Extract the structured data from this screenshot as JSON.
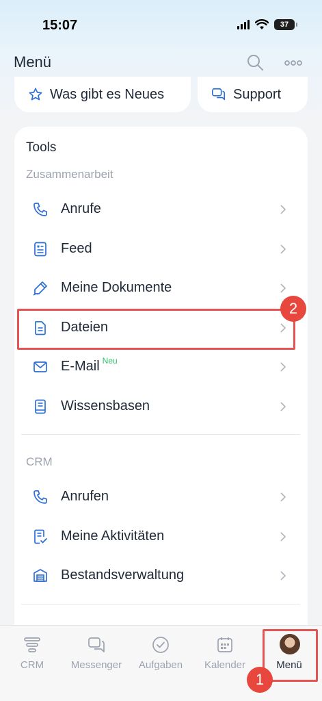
{
  "status": {
    "time": "15:07",
    "battery": "37"
  },
  "header": {
    "title": "Menü"
  },
  "quick": {
    "news_label": "Was gibt es Neues",
    "support_label": "Support"
  },
  "tools": {
    "title": "Tools",
    "collab_section": "Zusammenarbeit",
    "collab_items": [
      {
        "label": "Anrufe",
        "icon": "phone-icon"
      },
      {
        "label": "Feed",
        "icon": "feed-icon"
      },
      {
        "label": "Meine Dokumente",
        "icon": "pen-document-icon"
      },
      {
        "label": "Dateien",
        "icon": "file-icon"
      },
      {
        "label": "E-Mail",
        "badge": "Neu",
        "icon": "mail-icon"
      },
      {
        "label": "Wissensbasen",
        "icon": "book-icon"
      }
    ],
    "crm_section": "CRM",
    "crm_items": [
      {
        "label": "Anrufen",
        "icon": "phone-icon"
      },
      {
        "label": "Meine Aktivitäten",
        "icon": "checklist-icon"
      },
      {
        "label": "Bestandsverwaltung",
        "icon": "warehouse-icon"
      }
    ]
  },
  "annotations": {
    "step1": "1",
    "step2": "2"
  },
  "tabs": [
    {
      "label": "CRM",
      "icon": "crm-funnel-icon"
    },
    {
      "label": "Messenger",
      "icon": "chat-icon"
    },
    {
      "label": "Aufgaben",
      "icon": "check-circle-icon"
    },
    {
      "label": "Kalender",
      "icon": "calendar-icon"
    },
    {
      "label": "Menü",
      "icon": "avatar"
    }
  ],
  "colors": {
    "accent": "#2c6fd6",
    "highlight": "#e55353",
    "new_badge": "#2fc26b"
  }
}
